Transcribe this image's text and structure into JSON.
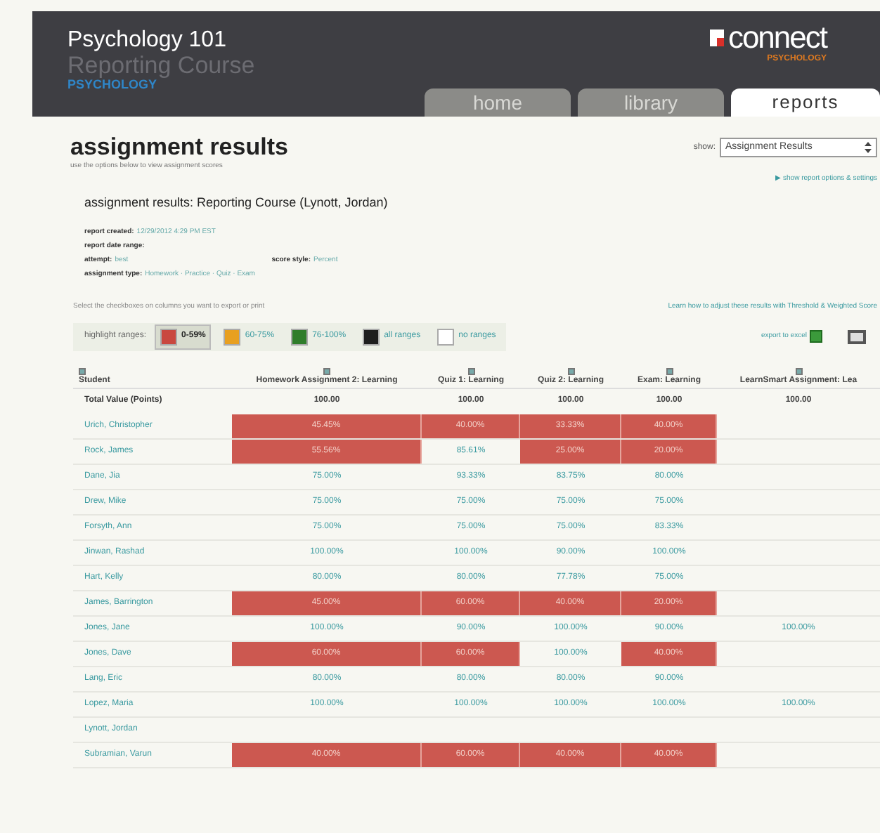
{
  "header": {
    "course": "Psychology 101",
    "section": "Reporting Course",
    "subject": "PSYCHOLOGY",
    "logo": "connect",
    "logo_sub": "PSYCHOLOGY"
  },
  "tabs": [
    {
      "label": "home",
      "selected": false
    },
    {
      "label": "library",
      "selected": false
    },
    {
      "label": "reports",
      "selected": true
    }
  ],
  "page": {
    "title": "assignment results",
    "subtitle": "use the options below to view assignment scores",
    "show_label": "show:",
    "show_value": "Assignment Results"
  },
  "options_link": "▶ show report options & settings",
  "report": {
    "title": "assignment results: Reporting Course  (Lynott, Jordan)",
    "details": [
      {
        "label": "report created:",
        "value": "12/29/2012 4:29 PM EST"
      },
      {
        "label": "report date range:"
      },
      {
        "label": "attempt:",
        "value": "best"
      },
      {
        "label": "assignment type:",
        "value": "Homework · Practice · Quiz · Exam"
      }
    ],
    "score_style": {
      "label": "score style:",
      "value": "Percent"
    }
  },
  "export_hint": "Select the checkboxes on columns you want to export or print",
  "learn_link": "Learn how to adjust these results with Threshold & Weighted Score",
  "highlight": {
    "label": "highlight ranges:",
    "ranges": [
      {
        "label": "0-59%",
        "color": "#c9483f",
        "selected": true
      },
      {
        "label": "60-75%",
        "color": "#e8a020",
        "selected": false
      },
      {
        "label": "76-100%",
        "color": "#2f7d2a",
        "selected": false
      },
      {
        "label": "all ranges",
        "color": "#1e1e1e",
        "selected": false
      },
      {
        "label": "no ranges",
        "color": "#ffffff",
        "selected": false
      }
    ]
  },
  "export_label": "export to excel",
  "table": {
    "columns": [
      {
        "label": "Student",
        "checked": true
      },
      {
        "label": "Homework Assignment 2: Learning",
        "checked": true
      },
      {
        "label": "Quiz 1: Learning",
        "checked": true
      },
      {
        "label": "Quiz 2: Learning",
        "checked": true
      },
      {
        "label": "Exam: Learning",
        "checked": true
      },
      {
        "label": "LearnSmart Assignment: Lea",
        "checked": true
      }
    ],
    "total": {
      "cells": [
        "Total Value (Points)",
        "100.00",
        "100.00",
        "100.00",
        "100.00",
        "100.00"
      ]
    },
    "rows": [
      {
        "cells": [
          {
            "value": "Urich, Christopher",
            "kind": "student"
          },
          {
            "value": "45.45%",
            "highlighted": true
          },
          {
            "value": "40.00%",
            "highlighted": true
          },
          {
            "value": "33.33%",
            "highlighted": true
          },
          {
            "value": "40.00%",
            "highlighted": true
          },
          null
        ]
      },
      {
        "cells": [
          {
            "value": "Rock, James",
            "kind": "student"
          },
          {
            "value": "55.56%",
            "highlighted": true
          },
          {
            "value": "85.61%",
            "highlighted": false
          },
          {
            "value": "25.00%",
            "highlighted": true
          },
          {
            "value": "20.00%",
            "highlighted": true
          },
          null
        ]
      },
      {
        "cells": [
          {
            "value": "Dane, Jia",
            "kind": "student"
          },
          {
            "value": "75.00%",
            "highlighted": false
          },
          {
            "value": "93.33%",
            "highlighted": false
          },
          {
            "value": "83.75%",
            "highlighted": false
          },
          {
            "value": "80.00%",
            "highlighted": false
          },
          null
        ]
      },
      {
        "cells": [
          {
            "value": "Drew, Mike",
            "kind": "student"
          },
          {
            "value": "75.00%",
            "highlighted": false
          },
          {
            "value": "75.00%",
            "highlighted": false
          },
          {
            "value": "75.00%",
            "highlighted": false
          },
          {
            "value": "75.00%",
            "highlighted": false
          },
          null
        ]
      },
      {
        "cells": [
          {
            "value": "Forsyth, Ann",
            "kind": "student"
          },
          {
            "value": "75.00%",
            "highlighted": false
          },
          {
            "value": "75.00%",
            "highlighted": false
          },
          {
            "value": "75.00%",
            "highlighted": false
          },
          {
            "value": "83.33%",
            "highlighted": false
          },
          null
        ]
      },
      {
        "cells": [
          {
            "value": "Jinwan, Rashad",
            "kind": "student"
          },
          {
            "value": "100.00%",
            "highlighted": false
          },
          {
            "value": "100.00%",
            "highlighted": false
          },
          {
            "value": "90.00%",
            "highlighted": false
          },
          {
            "value": "100.00%",
            "highlighted": false
          },
          null
        ]
      },
      {
        "cells": [
          {
            "value": "Hart, Kelly",
            "kind": "student"
          },
          {
            "value": "80.00%",
            "highlighted": false
          },
          {
            "value": "80.00%",
            "highlighted": false
          },
          {
            "value": "77.78%",
            "highlighted": false
          },
          {
            "value": "75.00%",
            "highlighted": false
          },
          null
        ]
      },
      {
        "cells": [
          {
            "value": "James, Barrington",
            "kind": "student"
          },
          {
            "value": "45.00%",
            "highlighted": true
          },
          {
            "value": "60.00%",
            "highlighted": true
          },
          {
            "value": "40.00%",
            "highlighted": true
          },
          {
            "value": "20.00%",
            "highlighted": true
          },
          null
        ]
      },
      {
        "cells": [
          {
            "value": "Jones, Jane",
            "kind": "student"
          },
          {
            "value": "100.00%",
            "highlighted": false
          },
          {
            "value": "90.00%",
            "highlighted": false
          },
          {
            "value": "100.00%",
            "highlighted": false
          },
          {
            "value": "90.00%",
            "highlighted": false
          },
          {
            "value": "100.00%",
            "highlighted": false
          }
        ]
      },
      {
        "cells": [
          {
            "value": "Jones, Dave",
            "kind": "student"
          },
          {
            "value": "60.00%",
            "highlighted": true
          },
          {
            "value": "60.00%",
            "highlighted": true
          },
          {
            "value": "100.00%",
            "highlighted": false
          },
          {
            "value": "40.00%",
            "highlighted": true
          },
          null
        ]
      },
      {
        "cells": [
          {
            "value": "Lang, Eric",
            "kind": "student"
          },
          {
            "value": "80.00%",
            "highlighted": false
          },
          {
            "value": "80.00%",
            "highlighted": false
          },
          {
            "value": "80.00%",
            "highlighted": false
          },
          {
            "value": "90.00%",
            "highlighted": false
          },
          null
        ]
      },
      {
        "cells": [
          {
            "value": "Lopez, Maria",
            "kind": "student"
          },
          {
            "value": "100.00%",
            "highlighted": false
          },
          {
            "value": "100.00%",
            "highlighted": false
          },
          {
            "value": "100.00%",
            "highlighted": false
          },
          {
            "value": "100.00%",
            "highlighted": false
          },
          {
            "value": "100.00%",
            "highlighted": false
          }
        ]
      },
      {
        "cells": [
          {
            "value": "Lynott, Jordan",
            "kind": "student"
          },
          null,
          null,
          null,
          null,
          null
        ]
      },
      {
        "cells": [
          {
            "value": "Subramian, Varun",
            "kind": "student"
          },
          {
            "value": "40.00%",
            "highlighted": true
          },
          {
            "value": "60.00%",
            "highlighted": true
          },
          {
            "value": "40.00%",
            "highlighted": true
          },
          {
            "value": "40.00%",
            "highlighted": true
          },
          null
        ]
      }
    ]
  }
}
